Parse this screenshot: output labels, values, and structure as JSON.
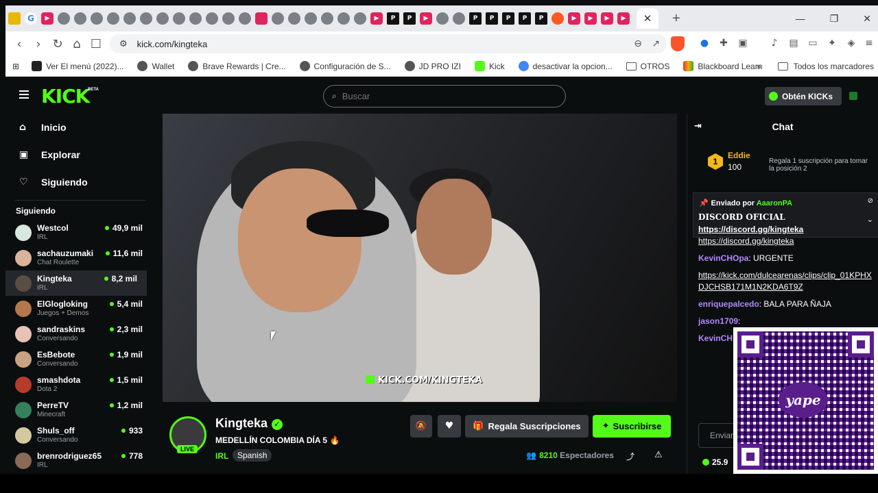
{
  "browser": {
    "address": "kick.com/kingteka",
    "bookmarks": [
      {
        "label": "Ver El menú (2022)...",
        "icon": "p-icon"
      },
      {
        "label": "Wallet",
        "icon": "globe-icon"
      },
      {
        "label": "Brave Rewards | Cre...",
        "icon": "globe-icon"
      },
      {
        "label": "Configuración de S...",
        "icon": "globe-icon"
      },
      {
        "label": "JD PRO IZI",
        "icon": "globe-icon"
      },
      {
        "label": "Kick",
        "icon": "kick-icon"
      },
      {
        "label": "desactivar la opcion...",
        "icon": "google-icon"
      },
      {
        "label": "OTROS",
        "icon": "folder-icon"
      },
      {
        "label": "Blackboard Learn",
        "icon": "blackboard-icon"
      }
    ],
    "all_bookmarks": "Todos los marcadores"
  },
  "header": {
    "logo": "KICK",
    "beta": "BETA",
    "search_placeholder": "Buscar",
    "get_kicks": "Obtén KICKs"
  },
  "sidebar": {
    "nav": [
      {
        "label": "Inicio",
        "icon": "⌂"
      },
      {
        "label": "Explorar",
        "icon": "▣"
      },
      {
        "label": "Siguiendo",
        "icon": "♡"
      }
    ],
    "following_heading": "Siguiendo",
    "channels": [
      {
        "name": "Westcol",
        "category": "IRL",
        "viewers": "49,9 mil",
        "color": "#d7e8e0"
      },
      {
        "name": "sachauzumaki",
        "category": "Chat Roulette",
        "viewers": "11,6 mil",
        "color": "#d9b39a"
      },
      {
        "name": "Kingteka",
        "category": "IRL",
        "viewers": "8,2 mil",
        "color": "#5a4d44"
      },
      {
        "name": "ElGlogloking",
        "category": "Juegos + Demos",
        "viewers": "5,4 mil",
        "color": "#b5784a"
      },
      {
        "name": "sandraskins",
        "category": "Conversando",
        "viewers": "2,3 mil",
        "color": "#e8c2b3"
      },
      {
        "name": "EsBebote",
        "category": "Conversando",
        "viewers": "1,9 mil",
        "color": "#c7a383"
      },
      {
        "name": "smashdota",
        "category": "Dota 2",
        "viewers": "1,5 mil",
        "color": "#b83a2a"
      },
      {
        "name": "PerreTV",
        "category": "Minecraft",
        "viewers": "1,2 mil",
        "color": "#34805c"
      },
      {
        "name": "Shuls_off",
        "category": "Conversando",
        "viewers": "933",
        "color": "#d4c8a0"
      },
      {
        "name": "brenrodriguez65",
        "category": "IRL",
        "viewers": "778",
        "color": "#8a6a55"
      }
    ]
  },
  "video": {
    "overlay_text": "KICK.COM/KINGTEKA"
  },
  "stream": {
    "channel": "Kingteka",
    "live_label": "LIVE",
    "title": "MEDELLÍN COLOMBIA DÍA 5 🔥",
    "category": "IRL",
    "language": "Spanish",
    "gift_button": "Regala Suscripciones",
    "subscribe_button": "Suscribirse",
    "viewer_count": "8210",
    "viewer_label": "Espectadores"
  },
  "chat": {
    "title": "Chat",
    "top_gifter": {
      "rank": "1",
      "name": "Eddie",
      "count": "100"
    },
    "gift_promo": "Regala 1 suscripción para tomar la posición 2",
    "pinned": {
      "pinned_by_label": "Enviado por",
      "pinned_by_user": "AaaronPA",
      "title": "DISCORD OFICIAL",
      "link": "https://discord.gg/kingteka"
    },
    "messages": [
      {
        "user": "",
        "text": "https://discord.gg/kingteka",
        "user_color": "#b388ff"
      },
      {
        "user": "KevinCHOpa",
        "text": "URGENTE",
        "user_color": "#b388ff"
      },
      {
        "user": "",
        "text": "https://kick.com/dulcearenas/clips/clip_01KPHXDJCHSB171M1N2KDA6T9Z",
        "user_color": "#b388ff"
      },
      {
        "user": "enriquepalcedo",
        "text": "BALA PARA ÑAJA",
        "user_color": "#b388ff"
      },
      {
        "user": "jason1709",
        "text": "",
        "user_color": "#b388ff"
      },
      {
        "user": "KevinCH",
        "text": "",
        "user_color": "#b388ff"
      }
    ],
    "input_placeholder": "Enviar",
    "balance": "25.9",
    "qr_label": "yape"
  }
}
